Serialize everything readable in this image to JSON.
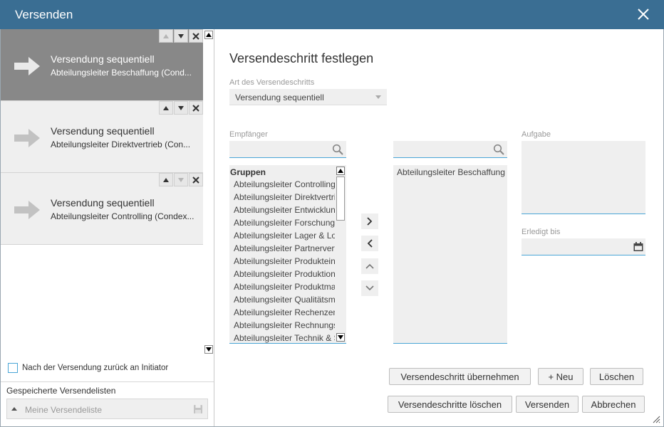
{
  "window": {
    "title": "Versenden"
  },
  "steps": [
    {
      "title": "Versendung sequentiell",
      "subtitle": "Abteilungsleiter Beschaffung (Cond...",
      "active": true
    },
    {
      "title": "Versendung sequentiell",
      "subtitle": "Abteilungsleiter Direktvertrieb (Con...",
      "active": false
    },
    {
      "title": "Versendung sequentiell",
      "subtitle": "Abteilungsleiter Controlling (Condex...",
      "active": false
    }
  ],
  "left": {
    "initiator_label": "Nach der Versendung zurück an Initiator",
    "initiator_checked": false,
    "saved_lists_label": "Gespeicherte Versendelisten",
    "saved_lists_placeholder": "Meine Versendeliste"
  },
  "right": {
    "heading": "Versendeschritt festlegen",
    "art_label": "Art des Versendeschritts",
    "art_value": "Versendung sequentiell",
    "recipients_label": "Empfänger",
    "recipient_search_value": "",
    "target_search_value": "",
    "group_header": "Gruppen",
    "recipients": [
      "Abteilungsleiter Controlling",
      "Abteilungsleiter Direktvertrieb",
      "Abteilungsleiter Entwicklung",
      "Abteilungsleiter Forschung",
      "Abteilungsleiter Lager & Logistik",
      "Abteilungsleiter Partnervertrieb",
      "Abteilungsleiter Produkteinführung",
      "Abteilungsleiter Produktion",
      "Abteilungsleiter Produktmanagement",
      "Abteilungsleiter Qualitätsmanagement",
      "Abteilungsleiter Rechenzentrum",
      "Abteilungsleiter Rechnungswesen",
      "Abteilungsleiter Technik & Service"
    ],
    "selected_recipients": [
      "Abteilungsleiter Beschaffung"
    ],
    "task_label": "Aufgabe",
    "task_value": "",
    "due_label": "Erledigt bis",
    "due_value": ""
  },
  "buttons": {
    "apply_step": "Versendeschritt übernehmen",
    "new": "+ Neu",
    "delete": "Löschen",
    "delete_steps": "Versendeschritte löschen",
    "send": "Versenden",
    "cancel": "Abbrechen"
  },
  "colors": {
    "titlebar": "#3a6e93",
    "accent": "#49a5d6",
    "active_step": "#888888"
  }
}
